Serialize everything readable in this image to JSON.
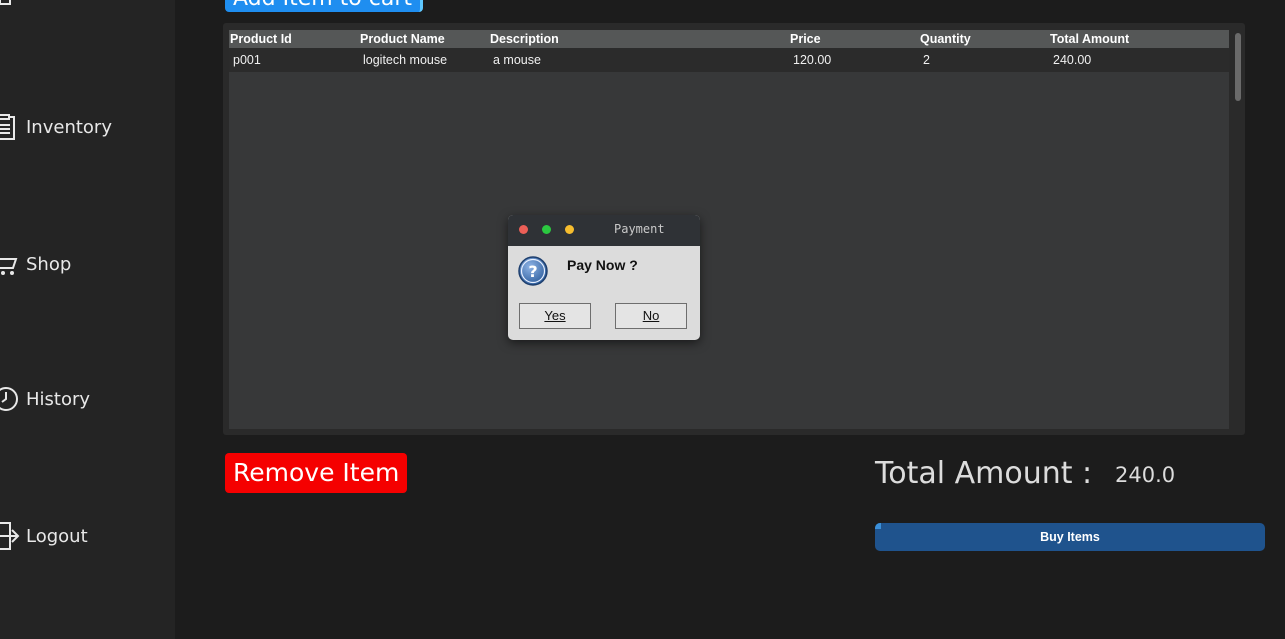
{
  "sidebar": {
    "items": [
      {
        "label": "Inventory",
        "icon": "clipboard-icon"
      },
      {
        "label": "Shop",
        "icon": "cart-icon"
      },
      {
        "label": "History",
        "icon": "clock-icon"
      },
      {
        "label": "Logout",
        "icon": "logout-icon"
      }
    ]
  },
  "header": {
    "add_item_label": "Add Item to cart"
  },
  "table": {
    "columns": [
      "Product Id",
      "Product Name",
      "Description",
      "Price",
      "Quantity",
      "Total Amount"
    ],
    "rows": [
      [
        "p001",
        "logitech mouse",
        "a mouse",
        "120.00",
        "2",
        "240.00"
      ]
    ]
  },
  "dialog": {
    "title": "Payment",
    "message": "Pay Now ?",
    "yes_label": "Yes",
    "no_label": "No",
    "icon": "question-icon"
  },
  "footer": {
    "remove_label": "Remove Item",
    "total_label": "Total Amount :",
    "total_value": "240.0",
    "buy_label": "Buy Items"
  },
  "colors": {
    "accent_blue": "#1f8ef0",
    "remove_red": "#f50000",
    "buy_blue": "#1f538d"
  }
}
